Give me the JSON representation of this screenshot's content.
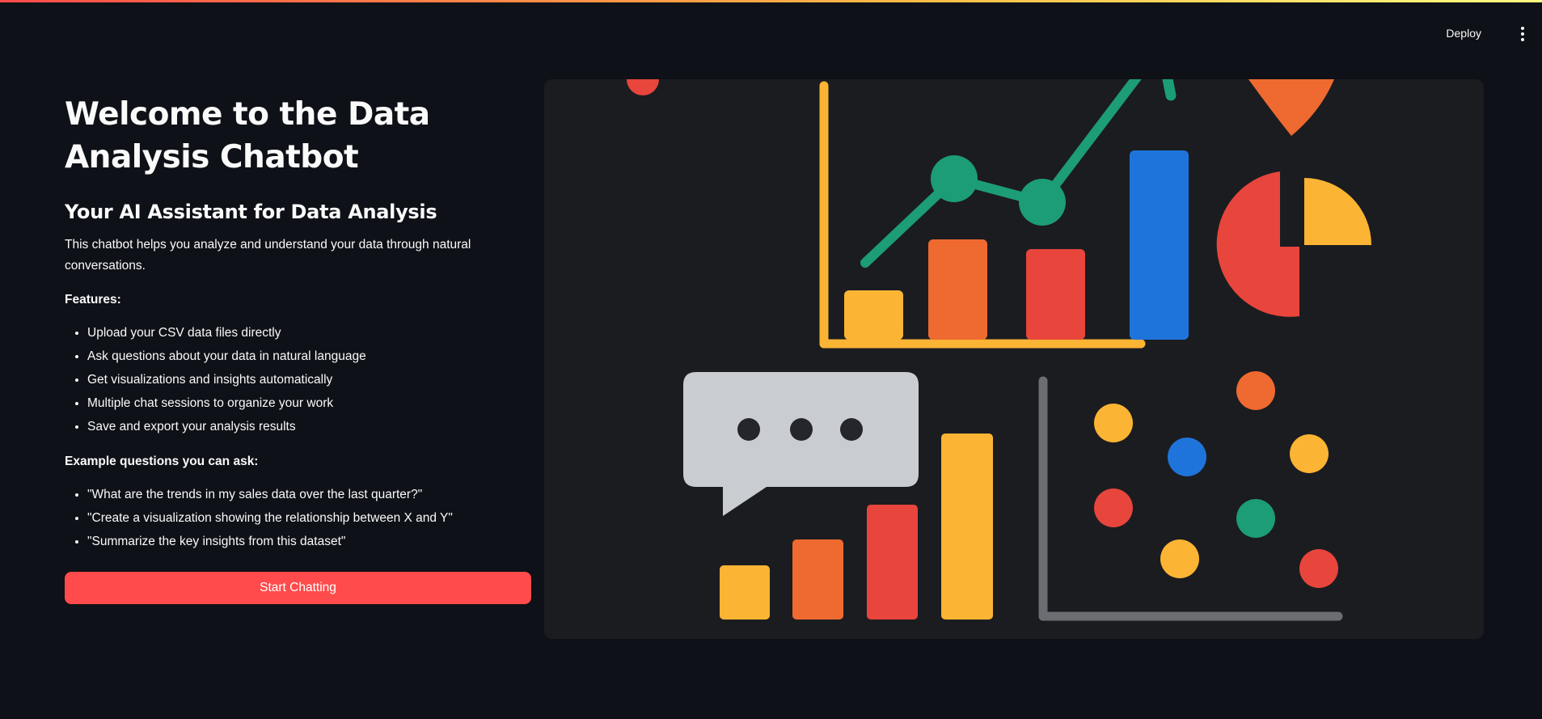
{
  "header": {
    "deploy_label": "Deploy",
    "menu_icon": "vertical-dots-icon"
  },
  "main": {
    "title": "Welcome to the Data Analysis Chatbot",
    "subtitle": "Your AI Assistant for Data Analysis",
    "intro": "This chatbot helps you analyze and understand your data through natural conversations.",
    "features_heading": "Features:",
    "features": [
      "Upload your CSV data files directly",
      "Ask questions about your data in natural language",
      "Get visualizations and insights automatically",
      "Multiple chat sessions to organize your work",
      "Save and export your analysis results"
    ],
    "examples_heading": "Example questions you can ask:",
    "examples": [
      "\"What are the trends in my sales data over the last quarter?\"",
      "\"Create a visualization showing the relationship between X and Y\"",
      "\"Summarize the key insights from this dataset\""
    ],
    "start_button_label": "Start Chatting"
  },
  "illustration": {
    "icon": "data-analytics-illustration-icon",
    "colors": {
      "panel": "#1b1c20",
      "yellow": "#fbb433",
      "orange": "#ef6a30",
      "red": "#e8453c",
      "blue": "#1f74dc",
      "green": "#1c9c77",
      "gray": "#c9cdd2",
      "axis_gray": "#6b6d72"
    }
  },
  "accent_color": "#ff4b4b"
}
